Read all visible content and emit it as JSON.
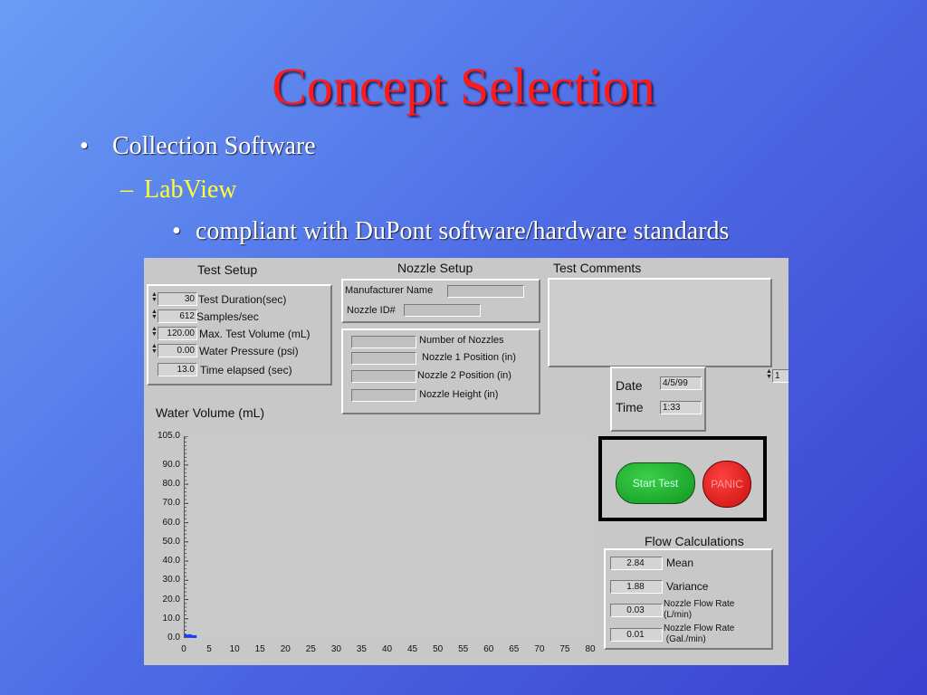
{
  "slide": {
    "title": "Concept Selection",
    "bullet1": "Collection Software",
    "bullet2": "LabView",
    "bullet3": "compliant with DuPont software/hardware standards",
    "marker1": "•",
    "marker2": "–",
    "marker3": "•"
  },
  "test_setup": {
    "title": "Test Setup",
    "rows": [
      {
        "value": "30",
        "label": "Test Duration(sec)"
      },
      {
        "value": "612",
        "label": "Samples/sec"
      },
      {
        "value": "120.00",
        "label": "Max. Test Volume (mL)"
      },
      {
        "value": "0.00",
        "label": "Water Pressure (psi)"
      },
      {
        "value": "13.0",
        "label": "Time elapsed (sec)"
      }
    ]
  },
  "nozzle_setup": {
    "title": "Nozzle Setup",
    "manufacturer_label": "Manufacturer Name",
    "nozzle_id_label": "Nozzle ID#",
    "fields": [
      "Number of Nozzles",
      "Nozzle 1 Position (in)",
      "Nozzle 2 Position (in)",
      "Nozzle Height (in)"
    ]
  },
  "test_comments": {
    "title": "Test Comments"
  },
  "index_spinner": {
    "value": "1"
  },
  "date_time": {
    "date_label": "Date",
    "date_value": "4/5/99",
    "time_label": "Time",
    "time_value": "1:33"
  },
  "controls": {
    "start_label": "Start Test",
    "panic_label": "PANIC"
  },
  "flow": {
    "title": "Flow Calculations",
    "rows": [
      {
        "value": "2.84",
        "label": "Mean",
        "label2": ""
      },
      {
        "value": "1.88",
        "label": "Variance",
        "label2": ""
      },
      {
        "value": "0.03",
        "label": "Nozzle Flow Rate",
        "label2": "(L/min)"
      },
      {
        "value": "0.01",
        "label": "Nozzle Flow Rate",
        "label2": " (Gal./min)"
      }
    ]
  },
  "chart_data": {
    "type": "line",
    "title": "Water Volume (mL)",
    "xlabel": "",
    "ylabel": "",
    "xlim": [
      0,
      80
    ],
    "ylim": [
      0,
      105
    ],
    "x_ticks": [
      "0",
      "5",
      "10",
      "15",
      "20",
      "25",
      "30",
      "35",
      "40",
      "45",
      "50",
      "55",
      "60",
      "65",
      "70",
      "75",
      "80"
    ],
    "y_ticks": [
      "105.0",
      "90.0",
      "80.0",
      "70.0",
      "60.0",
      "50.0",
      "40.0",
      "30.0",
      "20.0",
      "10.0",
      "0.0"
    ],
    "series": [
      {
        "x": [
          0,
          1,
          2
        ],
        "y": [
          1.2,
          1.0,
          0.5
        ],
        "color": "#1a3bff"
      }
    ],
    "grid": false
  },
  "colors": {
    "title": "#ff1a1a",
    "sub": "#ffff33",
    "panel": "#c8c8c8"
  }
}
